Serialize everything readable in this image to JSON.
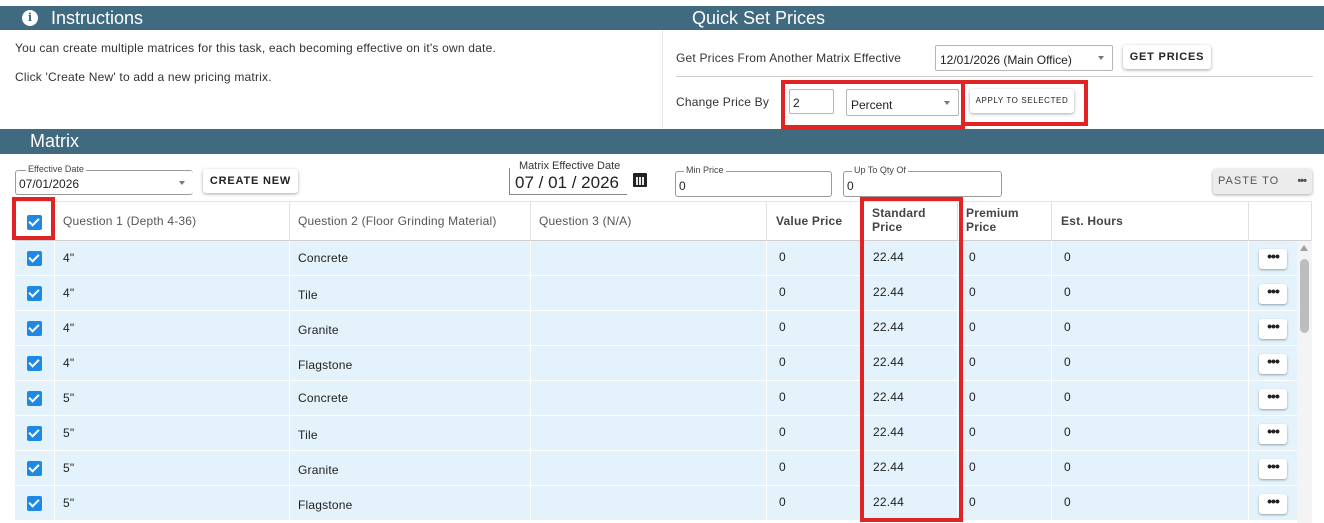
{
  "instructions": {
    "title": "Instructions",
    "line1": "You can create multiple matrices for this task, each becoming effective on it's own date.",
    "line2": "Click 'Create New' to add a new pricing matrix."
  },
  "quick_set": {
    "title": "Quick Set Prices",
    "get_prices_label": "Get Prices From Another Matrix Effective",
    "matrix_select_value": "12/01/2026 (Main Office)",
    "get_prices_button": "GET PRICES",
    "change_price_label": "Change Price By",
    "change_amount_value": "2",
    "change_type_value": "Percent",
    "apply_button": "APPLY TO SELECTED"
  },
  "matrix": {
    "title": "Matrix",
    "effective_date_legend": "Effective Date",
    "effective_date_value": "07/01/2026",
    "create_new_button": "CREATE NEW",
    "matrix_effective_date_legend": "Matrix Effective Date",
    "matrix_effective_date_value": "07 / 01 / 2026",
    "min_price_legend": "Min Price",
    "min_price_value": "0",
    "up_to_qty_legend": "Up To Qty Of",
    "up_to_qty_value": "0",
    "paste_to_button": "PASTE TO"
  },
  "columns": {
    "q1": "Question 1 (Depth 4-36)",
    "q2": "Question 2 (Floor Grinding Material)",
    "q3": "Question 3 (N/A)",
    "value_price": "Value Price",
    "standard_price": "Standard Price",
    "premium_price": "Premium Price",
    "est_hours": "Est. Hours"
  },
  "rows": [
    {
      "q1": "4\"",
      "q2": "Concrete",
      "value": "0",
      "standard": "22.44",
      "premium": "0",
      "hours": "0"
    },
    {
      "q1": "4\"",
      "q2": "Tile",
      "value": "0",
      "standard": "22.44",
      "premium": "0",
      "hours": "0"
    },
    {
      "q1": "4\"",
      "q2": "Granite",
      "value": "0",
      "standard": "22.44",
      "premium": "0",
      "hours": "0"
    },
    {
      "q1": "4\"",
      "q2": "Flagstone",
      "value": "0",
      "standard": "22.44",
      "premium": "0",
      "hours": "0"
    },
    {
      "q1": "5\"",
      "q2": "Concrete",
      "value": "0",
      "standard": "22.44",
      "premium": "0",
      "hours": "0"
    },
    {
      "q1": "5\"",
      "q2": "Tile",
      "value": "0",
      "standard": "22.44",
      "premium": "0",
      "hours": "0"
    },
    {
      "q1": "5\"",
      "q2": "Granite",
      "value": "0",
      "standard": "22.44",
      "premium": "0",
      "hours": "0"
    },
    {
      "q1": "5\"",
      "q2": "Flagstone",
      "value": "0",
      "standard": "22.44",
      "premium": "0",
      "hours": "0"
    }
  ],
  "icons": {
    "info": "info-icon",
    "calendar": "calendar-icon",
    "more": "more-horizontal-icon",
    "checkbox": "checkbox-checked-icon"
  },
  "colors": {
    "header_bar": "#3f6a80",
    "row_bg": "#e3f2fb",
    "checkbox": "#1e88e5",
    "highlight": "#e02424"
  }
}
